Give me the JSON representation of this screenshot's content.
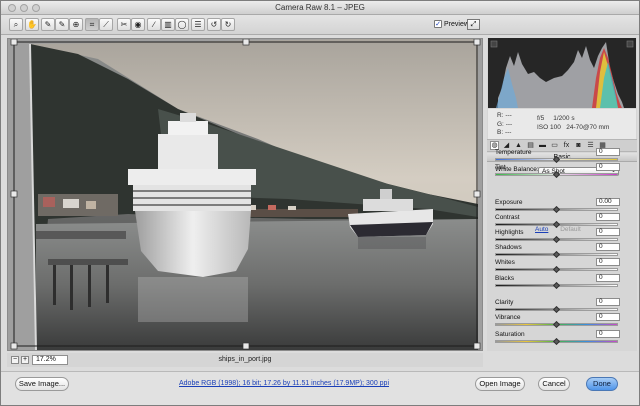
{
  "window": {
    "title": "Camera Raw 8.1  –  JPEG"
  },
  "toolbar": {
    "tools": [
      {
        "name": "zoom-tool",
        "icon": "magnifier-icon",
        "glyph": "⌕"
      },
      {
        "name": "hand-tool",
        "icon": "hand-icon",
        "glyph": "✋"
      },
      {
        "name": "white-balance-tool",
        "icon": "eyedropper-icon",
        "glyph": "✎"
      },
      {
        "name": "color-sampler-tool",
        "icon": "color-sampler-icon",
        "glyph": "✎"
      },
      {
        "name": "targeted-adjustment-tool",
        "icon": "target-icon",
        "glyph": "⊕"
      },
      {
        "name": "crop-tool",
        "icon": "crop-icon",
        "glyph": "⌗"
      },
      {
        "name": "straighten-tool",
        "icon": "straighten-icon",
        "glyph": "⟋"
      },
      {
        "name": "spot-removal-tool",
        "icon": "spot-removal-icon",
        "glyph": "✂"
      },
      {
        "name": "red-eye-tool",
        "icon": "red-eye-icon",
        "glyph": "◉"
      },
      {
        "name": "adjustment-brush-tool",
        "icon": "brush-icon",
        "glyph": "∕"
      },
      {
        "name": "graduated-filter-tool",
        "icon": "graduated-filter-icon",
        "glyph": "▥"
      },
      {
        "name": "radial-filter-tool",
        "icon": "radial-filter-icon",
        "glyph": "◯"
      },
      {
        "name": "preferences-tool",
        "icon": "list-icon",
        "glyph": "☰"
      },
      {
        "name": "rotate-left-tool",
        "icon": "rotate-left-icon",
        "glyph": "↺"
      },
      {
        "name": "rotate-right-tool",
        "icon": "rotate-right-icon",
        "glyph": "↻"
      }
    ],
    "preview_label": "Preview",
    "preview_checked": true
  },
  "status": {
    "zoom": "17.2%",
    "filename": "ships_in_port.jpg"
  },
  "info": {
    "r": "R:",
    "g": "G:",
    "b": "B:",
    "dash": "---",
    "aperture": "f/5",
    "shutter": "1/200 s",
    "iso": "ISO 100",
    "lens": "24-70@70 mm"
  },
  "panel": {
    "tabs": [
      "basic-icon",
      "tone-curve-icon",
      "detail-icon",
      "hsl-icon",
      "split-toning-icon",
      "lens-icon",
      "fx-icon",
      "camera-calibration-icon",
      "presets-icon",
      "snapshots-icon"
    ],
    "title": "Basic",
    "white_balance_label": "White Balance:",
    "white_balance_value": "As Shot",
    "auto": "Auto",
    "default": "Default",
    "sliders": [
      {
        "name": "temperature",
        "label": "Temperature",
        "value": "0",
        "pos": 0.5,
        "track": "temp"
      },
      {
        "name": "tint",
        "label": "Tint",
        "value": "0",
        "pos": 0.5,
        "track": "tint"
      },
      {
        "name": "exposure",
        "label": "Exposure",
        "value": "0.00",
        "pos": 0.5,
        "track": "gray"
      },
      {
        "name": "contrast",
        "label": "Contrast",
        "value": "0",
        "pos": 0.5,
        "track": "gray"
      },
      {
        "name": "highlights",
        "label": "Highlights",
        "value": "0",
        "pos": 0.5,
        "track": "gray"
      },
      {
        "name": "shadows",
        "label": "Shadows",
        "value": "0",
        "pos": 0.5,
        "track": "gray"
      },
      {
        "name": "whites",
        "label": "Whites",
        "value": "0",
        "pos": 0.5,
        "track": "gray"
      },
      {
        "name": "blacks",
        "label": "Blacks",
        "value": "0",
        "pos": 0.5,
        "track": "gray"
      },
      {
        "name": "clarity",
        "label": "Clarity",
        "value": "0",
        "pos": 0.5,
        "track": "gray"
      },
      {
        "name": "vibrance",
        "label": "Vibrance",
        "value": "0",
        "pos": 0.5,
        "track": "sat"
      },
      {
        "name": "saturation",
        "label": "Saturation",
        "value": "0",
        "pos": 0.5,
        "track": "sat"
      }
    ]
  },
  "bottom": {
    "save": "Save Image...",
    "workflow": "Adobe RGB (1998); 16 bit; 17.26 by 11.51 inches (17.9MP); 300 ppi",
    "open": "Open Image",
    "cancel": "Cancel",
    "done": "Done"
  }
}
